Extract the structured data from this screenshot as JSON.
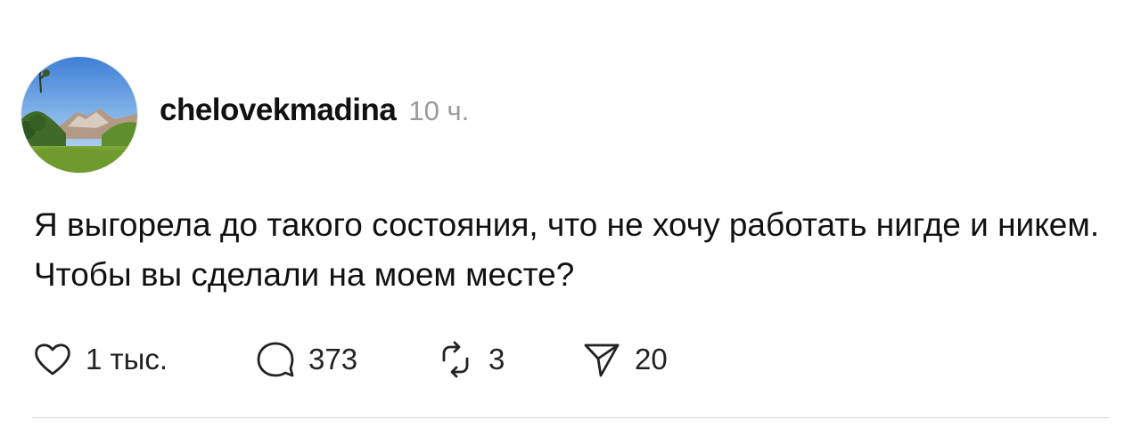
{
  "post": {
    "author": {
      "username": "chelovekmadina",
      "avatar_icon": "mountain-landscape-avatar"
    },
    "timestamp": "10 ч.",
    "text": "Я выгорела до такого состояния, что не хочу работать нигде и никем. Чтобы вы сделали на моем месте?",
    "actions": {
      "likes": {
        "icon": "heart-icon",
        "count": "1 тыс."
      },
      "comments": {
        "icon": "comment-bubble-icon",
        "count": "373"
      },
      "reposts": {
        "icon": "repost-icon",
        "count": "3"
      },
      "shares": {
        "icon": "send-icon",
        "count": "20"
      }
    }
  },
  "colors": {
    "text": "#111111",
    "muted": "#9a9a9a",
    "divider": "#d6d6d6",
    "background": "#ffffff"
  }
}
